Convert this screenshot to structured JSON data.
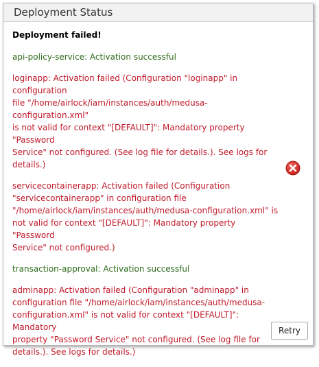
{
  "dialog": {
    "title": "Deployment Status",
    "headline": "Deployment failed!",
    "status_icon": "error-x-icon",
    "colors": {
      "success": "#2e6b1b",
      "error": "#c0192a",
      "icon": "#d9302c"
    },
    "messages": [
      {
        "type": "success",
        "text": "api-policy-service: Activation successful"
      },
      {
        "type": "error",
        "text": "loginapp: Activation failed (Configuration \"loginapp\" in configuration\nfile \"/home/airlock/iam/instances/auth/medusa-configuration.xml\"\nis not valid for context \"[DEFAULT]\": Mandatory property \"Password\nService\" not configured. (See log file for details.). See logs for\ndetails.)"
      },
      {
        "type": "error",
        "text": "servicecontainerapp: Activation failed (Configuration\n\"servicecontainerapp\" in configuration file\n\"/home/airlock/iam/instances/auth/medusa-configuration.xml\" is\nnot valid for context \"[DEFAULT]\": Mandatory property \"Password\nService\" not configured.)"
      },
      {
        "type": "success",
        "text": "transaction-approval: Activation successful"
      },
      {
        "type": "error",
        "text": "adminapp: Activation failed (Configuration \"adminapp\" in\nconfiguration file \"/home/airlock/iam/instances/auth/medusa-\nconfiguration.xml\" is not valid for context \"[DEFAULT]\": Mandatory\nproperty \"Password Service\" not configured. (See log file for\ndetails.). See logs for details.)"
      }
    ],
    "retry_label": "Retry"
  }
}
